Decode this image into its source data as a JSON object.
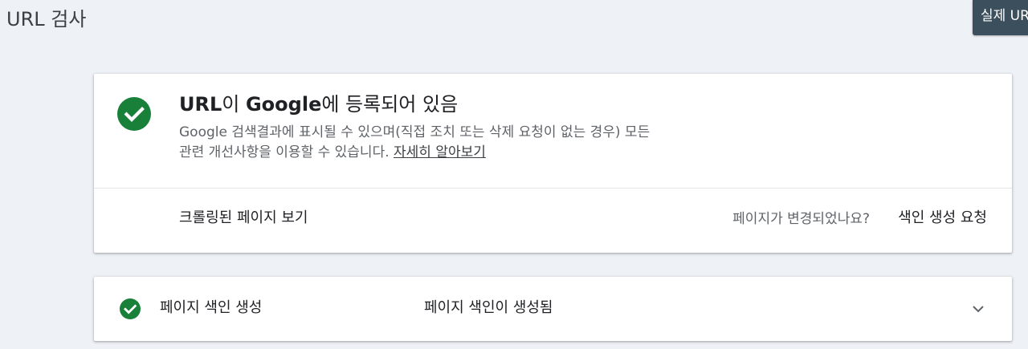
{
  "header": {
    "title": "URL 검사",
    "test_live_button": "실제 URL 테스트"
  },
  "status_card": {
    "icon": "check-circle-icon",
    "title_prefix": "URL",
    "title_mid": "이 ",
    "title_brand": "Google",
    "title_suffix": "에 등록되어 있음",
    "description_line1": "Google 검색결과에 표시될 수 있으며(직접 조치 또는 삭제 요청이 없는 경우) 모든",
    "description_line2": "관련 개선사항을 이용할 수 있습니다. ",
    "learn_more": "자세히 알아보기",
    "view_crawled_page": "크롤링된 페이지 보기",
    "page_changed_question": "페이지가 변경되었나요?",
    "request_indexing": "색인 생성 요청"
  },
  "coverage_card": {
    "icon": "check-circle-icon",
    "label": "페이지 색인 생성",
    "value": "페이지 색인이 생성됨",
    "expand_icon": "chevron-down-icon"
  },
  "colors": {
    "success_green": "#188038",
    "background": "#eef1f6",
    "button_dark": "#3c4f5c"
  }
}
